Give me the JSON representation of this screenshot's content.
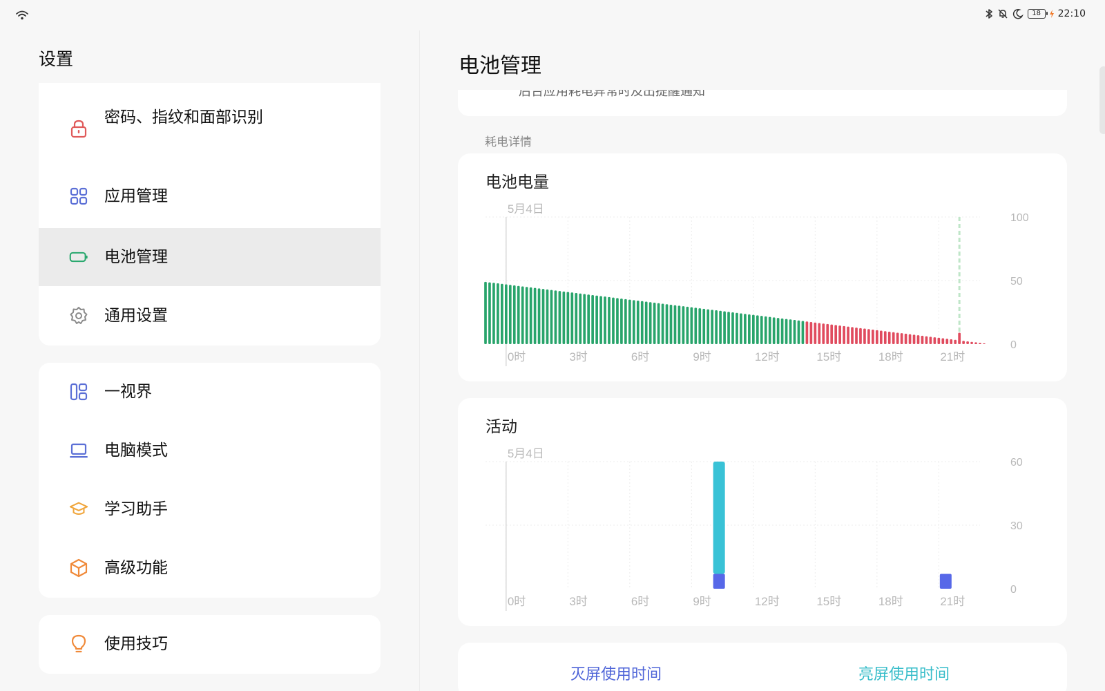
{
  "status": {
    "time": "22:10",
    "battery_level": "18"
  },
  "left": {
    "title": "设置",
    "groups": [
      [
        {
          "label": "密码、指纹和面部识别",
          "icon": "lock-icon",
          "color": "#e05a5a"
        },
        {
          "label": "应用管理",
          "icon": "apps-grid-icon",
          "color": "#5b6fd6"
        },
        {
          "label": "电池管理",
          "icon": "battery-icon",
          "color": "#29a86e",
          "active": true
        },
        {
          "label": "通用设置",
          "icon": "gear-icon",
          "color": "#8a8a8a"
        }
      ],
      [
        {
          "label": "一视界",
          "icon": "split-view-icon",
          "color": "#5b6fd6"
        },
        {
          "label": "电脑模式",
          "icon": "laptop-icon",
          "color": "#5b6fd6"
        },
        {
          "label": "学习助手",
          "icon": "graduation-cap-icon",
          "color": "#f0a53a"
        },
        {
          "label": "高级功能",
          "icon": "cube-icon",
          "color": "#f08a3a"
        }
      ],
      [
        {
          "label": "使用技巧",
          "icon": "lightbulb-icon",
          "color": "#f08a3a"
        }
      ]
    ]
  },
  "right": {
    "title": "电池管理",
    "top_card_text": "后台应用耗电异常时及出提醒通知",
    "section_label": "耗电详情",
    "tabs": {
      "off": "灭屏使用时间",
      "on": "亮屏使用时间"
    }
  },
  "chart_data": [
    {
      "type": "bar",
      "title": "电池电量",
      "date_label": "5月4日",
      "x_ticks": [
        "0时",
        "3时",
        "6时",
        "9时",
        "12时",
        "15时",
        "18时",
        "21时"
      ],
      "y_ticks": [
        "100",
        "50",
        "0"
      ],
      "ylim": [
        0,
        100
      ],
      "x_range_hours": [
        -1,
        23
      ],
      "colors": {
        "normal": "#28a46b",
        "low": "#e04b5e",
        "charging_line": "#bfe6c8"
      },
      "low_threshold_hour": 14.5,
      "series": [
        {
          "start_hour": -1,
          "interval_hours": 0.2,
          "values": [
            49,
            48.6,
            48.2,
            47.8,
            47.4,
            47,
            46.6,
            46.2,
            45.8,
            45.4,
            45,
            44.6,
            44.2,
            43.8,
            43.4,
            43,
            42.6,
            42.2,
            41.8,
            41.4,
            41,
            40.6,
            40.2,
            39.8,
            39.4,
            39,
            38.6,
            38.2,
            37.8,
            37.4,
            37,
            36.6,
            36.2,
            35.8,
            35.4,
            35,
            34.6,
            34.2,
            33.8,
            33.4,
            33,
            32.6,
            32.2,
            31.8,
            31.4,
            31,
            30.6,
            30.2,
            29.8,
            29.4,
            29,
            28.6,
            28.2,
            27.8,
            27.4,
            27,
            26.6,
            26.2,
            25.8,
            25.4,
            25,
            24.6,
            24.2,
            23.8,
            23.4,
            23,
            22.6,
            22.2,
            21.8,
            21.4,
            21,
            20.6,
            20.2,
            19.8,
            19.4,
            19,
            18.6,
            18.2,
            17.8,
            17.4,
            17,
            16.6,
            16.2,
            15.8,
            15.4,
            15,
            14.6,
            14.2,
            13.8,
            13.4,
            13,
            12.6,
            12.2,
            11.8,
            11.4,
            11,
            10.6,
            10.2,
            9.8,
            9.4,
            9,
            8.6,
            8.2,
            7.8,
            7.4,
            7,
            6.6,
            6.2,
            5.8,
            5.4,
            5,
            4.6,
            4.2,
            3.8,
            3.4,
            3,
            2.6,
            2.2,
            1.8,
            1.4,
            1,
            0.6
          ]
        },
        {
          "name": "",
          "note_hour": 22,
          "value": 9
        }
      ],
      "charging_marker_hour": 22
    },
    {
      "type": "bar",
      "title": "活动",
      "date_label": "5月4日",
      "x_ticks": [
        "0时",
        "3时",
        "6时",
        "9时",
        "12时",
        "15时",
        "18时",
        "21时"
      ],
      "y_ticks": [
        "60",
        "30",
        "0"
      ],
      "ylim": [
        0,
        60
      ],
      "x_range_hours": [
        -1,
        23
      ],
      "colors": {
        "on": "#39c2d6",
        "off": "#5768e8"
      },
      "bars": [
        {
          "hour": 10,
          "on": 53,
          "off": 7
        },
        {
          "hour": 21,
          "on": 0,
          "off": 7
        }
      ]
    }
  ]
}
